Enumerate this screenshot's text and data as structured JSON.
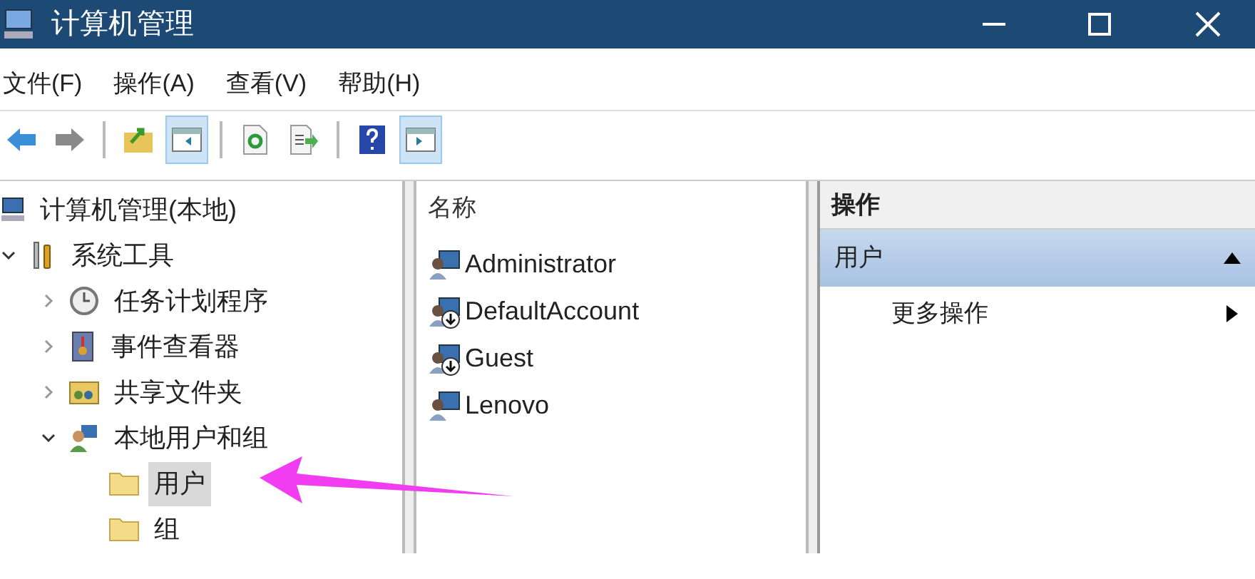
{
  "window": {
    "title": "计算机管理"
  },
  "menu": [
    "文件(F)",
    "操作(A)",
    "查看(V)",
    "帮助(H)"
  ],
  "toolbar": [
    {
      "kind": "back",
      "pressed": false
    },
    {
      "kind": "forward",
      "pressed": false
    },
    {
      "kind": "separator"
    },
    {
      "kind": "up",
      "pressed": false
    },
    {
      "kind": "tree",
      "pressed": true
    },
    {
      "kind": "separator"
    },
    {
      "kind": "refresh",
      "pressed": false
    },
    {
      "kind": "export",
      "pressed": false
    },
    {
      "kind": "separator"
    },
    {
      "kind": "help",
      "pressed": false
    },
    {
      "kind": "actions",
      "pressed": true
    }
  ],
  "tree": [
    {
      "label": "计算机管理(本地)",
      "kind": "computer",
      "selected": false,
      "children": [
        {
          "label": "系统工具",
          "kind": "tools",
          "expanded": true,
          "selected": false,
          "children": [
            {
              "label": "任务计划程序",
              "kind": "clock",
              "expanded": false,
              "selected": false
            },
            {
              "label": "事件查看器",
              "kind": "event",
              "expanded": false,
              "selected": false
            },
            {
              "label": "共享文件夹",
              "kind": "share",
              "expanded": false,
              "selected": false
            },
            {
              "label": "本地用户和组",
              "kind": "users",
              "expanded": true,
              "selected": false,
              "children": [
                {
                  "label": "用户",
                  "kind": "folder",
                  "selected": true
                },
                {
                  "label": "组",
                  "kind": "folder",
                  "selected": false
                }
              ]
            }
          ]
        }
      ]
    }
  ],
  "list": {
    "column": "名称",
    "rows": [
      {
        "name": "Administrator",
        "disabled": false
      },
      {
        "name": "DefaultAccount",
        "disabled": true
      },
      {
        "name": "Guest",
        "disabled": true
      },
      {
        "name": "Lenovo",
        "disabled": false
      }
    ]
  },
  "actions": {
    "header": "操作",
    "section": {
      "label": "用户",
      "expanded": true
    },
    "items": [
      {
        "label": "更多操作"
      }
    ]
  }
}
